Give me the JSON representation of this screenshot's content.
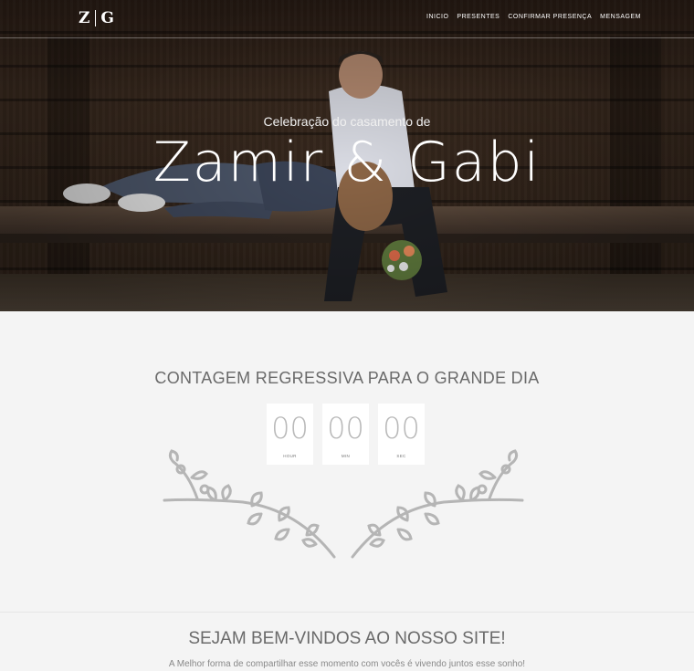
{
  "nav": {
    "logo_left": "Z",
    "logo_right": "G",
    "links": [
      "INICIO",
      "PRESENTES",
      "CONFIRMAR PRESENÇA",
      "MENSAGEM"
    ]
  },
  "hero": {
    "subtitle": "Celebração do casamento de",
    "title": "Zamir & Gabi"
  },
  "countdown": {
    "title": "CONTAGEM REGRESSIVA PARA O GRANDE DIA",
    "units": [
      {
        "value": "00",
        "label": "HOUR"
      },
      {
        "value": "00",
        "label": "MIN"
      },
      {
        "value": "00",
        "label": "SEC"
      }
    ]
  },
  "welcome": {
    "title": "SEJAM BEM-VINDOS AO NOSSO SITE!",
    "text": "A Melhor forma de compartilhar esse momento com vocês é vivendo juntos esse sonho!"
  },
  "colors": {
    "page_background": "#f4f4f4",
    "heading_text": "#6a6a6a",
    "countdown_digits": "#b9b9b9",
    "wreath_stroke": "#b5b5b5"
  }
}
